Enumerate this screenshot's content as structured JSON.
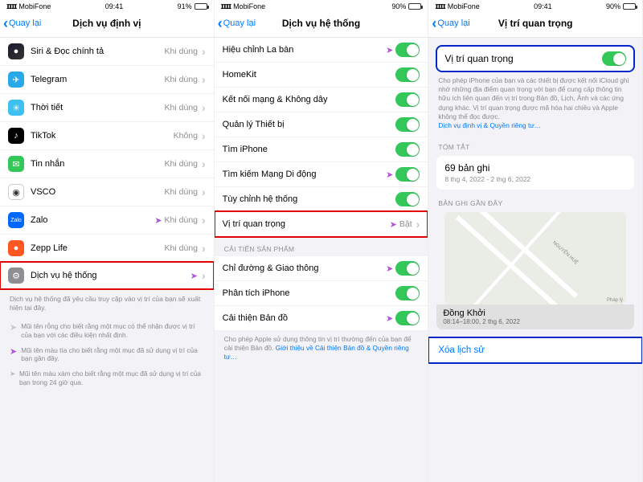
{
  "status": {
    "carrier": "MobiFone",
    "time": "09:41",
    "batt1": "91%",
    "batt2": "90%",
    "batt3": "90%"
  },
  "nav": {
    "back": "Quay lại",
    "t1": "Dịch vụ định vị",
    "t2": "Dịch vụ hệ thống",
    "t3": "Vị trí quan trọng"
  },
  "s1": {
    "apps": [
      {
        "name": "Siri & Đọc chính tả",
        "status": "Khi dùng",
        "c": "ic-siri",
        "g": "●"
      },
      {
        "name": "Telegram",
        "status": "Khi dùng",
        "c": "ic-tg",
        "g": "✈"
      },
      {
        "name": "Thời tiết",
        "status": "Khi dùng",
        "c": "ic-weather",
        "g": "☀"
      },
      {
        "name": "TikTok",
        "status": "Không",
        "c": "ic-tiktok",
        "g": "♪"
      },
      {
        "name": "Tin nhắn",
        "status": "Khi dùng",
        "c": "ic-msg",
        "g": "✉"
      },
      {
        "name": "VSCO",
        "status": "Khi dùng",
        "c": "ic-vsco",
        "g": "◉"
      },
      {
        "name": "Zalo",
        "status": "Khi dùng",
        "c": "ic-zalo",
        "g": "Zalo",
        "arrow": "p"
      },
      {
        "name": "Zepp Life",
        "status": "Khi dùng",
        "c": "ic-zepp",
        "g": "●"
      }
    ],
    "sys": "Dịch vụ hệ thống",
    "note": "Dịch vụ hệ thống đã yêu cầu truy cập vào vị trí của bạn sẽ xuất hiện tại đây.",
    "leg1": "Mũi tên rỗng cho biết rằng một mục có thể nhận được vị trí của bạn với các điều kiện nhất định.",
    "leg2": "Mũi tên màu tía cho biết rằng một mục đã sử dụng vị trí của bạn gần đây.",
    "leg3": "Mũi tên màu xám cho biết rằng một mục đã sử dụng vị trí của bạn trong 24 giờ qua."
  },
  "s2": {
    "items": [
      {
        "name": "Hiệu chỉnh La bàn",
        "arrow": "p"
      },
      {
        "name": "HomeKit"
      },
      {
        "name": "Kết nối mạng & Không dây"
      },
      {
        "name": "Quản lý Thiết bị"
      },
      {
        "name": "Tìm iPhone"
      },
      {
        "name": "Tìm kiếm Mạng Di động",
        "arrow": "p"
      },
      {
        "name": "Tùy chỉnh hệ thống"
      }
    ],
    "sig": {
      "name": "Vị trí quan trọng",
      "status": "Bật"
    },
    "section": "CẢI TIẾN SẢN PHẨM",
    "improve": [
      {
        "name": "Chỉ đường & Giao thông",
        "arrow": "p"
      },
      {
        "name": "Phân tích iPhone"
      },
      {
        "name": "Cải thiện Bản đồ",
        "arrow": "p"
      }
    ],
    "note": "Cho phép Apple sử dụng thông tin vị trí thường đến của bạn để cải thiện Bản đồ.",
    "notelink": "Giới thiệu về Cải thiện Bản đồ & Quyền riêng tư…"
  },
  "s3": {
    "toggle": "Vị trí quan trọng",
    "desc": "Cho phép iPhone của bạn và các thiết bị được kết nối iCloud ghi nhớ những địa điểm quan trọng với bạn để cung cấp thông tin hữu ích liên quan đến vị trí trong Bản đồ, Lịch, Ảnh và các ứng dụng khác. Vị trí quan trọng được mã hóa hai chiều và Apple không thể đọc được.",
    "desclink": "Dịch vụ định vị & Quyền riêng tư…",
    "summary_h": "TÓM TẮT",
    "summary": "69 bản ghi",
    "summary_sub": "8 thg 4, 2022 - 2 thg 6, 2022",
    "recent_h": "BẢN GHI GẦN ĐÂY",
    "road": "NGUYỄN HUỆ",
    "phap": "Pháp lý",
    "place": "Đồng Khởi",
    "place_sub": "08:14–18:00, 2 thg 6, 2022",
    "clear": "Xóa lịch sử"
  }
}
